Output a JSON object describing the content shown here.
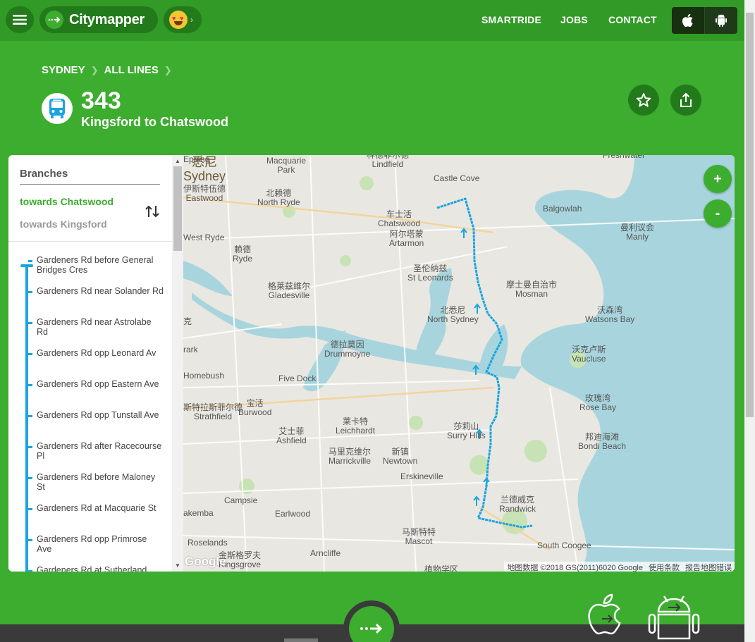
{
  "header": {
    "brand": "Citymapper",
    "nav": [
      "SMARTRIDE",
      "JOBS",
      "CONTACT"
    ],
    "icons": {
      "menu": "hamburger-icon",
      "apple": "apple-icon",
      "android": "android-icon",
      "emoji": "heart-eyes-emoji"
    }
  },
  "breadcrumb": [
    "SYDNEY",
    "ALL LINES"
  ],
  "route": {
    "number": "343",
    "name": "Kingsford to Chatswood"
  },
  "branches": {
    "heading": "Branches",
    "active": "towards Chatswood",
    "inactive": "towards Kingsford"
  },
  "stops": [
    "Gardeners Rd before General Bridges Cres",
    "Gardeners Rd near Solander Rd",
    "Gardeners Rd near Astrolabe Rd",
    "Gardeners Rd opp Leonard Av",
    "Gardeners Rd opp Eastern Ave",
    "Gardeners Rd opp Tunstall Ave",
    "Gardeners Rd after Racecourse Pl",
    "Gardeners Rd before Maloney St",
    "Gardeners Rd at Macquarie St",
    "Gardeners Rd opp Primrose Ave",
    "Gardeners Rd at Sutherland"
  ],
  "map": {
    "zoom_in": "+",
    "zoom_out": "-",
    "google": "Google",
    "attribution": [
      "地图数据 ©2018 GS(2011)6020 Google",
      "使用条款",
      "报告地图错误"
    ],
    "labels": {
      "epping": "Epping",
      "lindfield": "林德菲尔德\nLindfield",
      "freshwater": "Freshwater",
      "macquarie_park": "Macquarie\nPark",
      "castle_cove": "Castle Cove",
      "eastwood": "伊斯特伍德\nEastwood",
      "north_ryde": "北赖德\nNorth Ryde",
      "balgowlah": "Balgowlah",
      "chatswood": "车士活\nChatswood",
      "artarmon": "阿尔塔蒙\nArtarmon",
      "manly": "曼利议会\nManly",
      "west_ryde": "West Ryde",
      "ryde": "赖德\nRyde",
      "st_leonards": "圣伦纳兹\nSt Leonards",
      "gladesville": "格莱兹维尔\nGladesville",
      "mosman": "摩士曼自治市\nMosman",
      "north_sydney": "北悉尼\nNorth Sydney",
      "watsons_bay": "沃森湾\nWatsons Bay",
      "drummoyne": "德拉莫因\nDrummoyne",
      "vaucluse": "沃克卢斯\nVaucluse",
      "homebush": "Homebush",
      "five_dock": "Five Dock",
      "sydney": "悉尼\nSydney",
      "burwood": "宝活\nBurwood",
      "strathfield": "斯特拉斯菲尔德\nStrathfield",
      "leichhardt": "莱卡特\nLeichhardt",
      "rose_bay": "玫瑰湾\nRose Bay",
      "surry_hills": "莎莉山\nSurry Hills",
      "ashfield": "艾士菲\nAshfield",
      "bondi_beach": "邦迪海滩\nBondi Beach",
      "newtown": "新镇\nNewtown",
      "erskineville": "Erskineville",
      "marrickville": "马里克维尔\nMarrickville",
      "campsie": "Campsie",
      "randwick": "兰德威克\nRandwick",
      "lakemba": "akemba",
      "earlwood": "Earlwood",
      "mascot": "马斯特特\nMascot",
      "roselands": "Roselands",
      "south_coogee": "South Coogee",
      "kingsgrove": "金斯格罗夫\nKingsgrove",
      "arncliffe": "Arncliffe",
      "rark": "rark",
      "ke": "克",
      "botany": "植物学区"
    }
  },
  "colors": {
    "brand_green": "#3cad2e",
    "dark_green": "#237a1a",
    "route_blue": "#1aa5e0"
  }
}
